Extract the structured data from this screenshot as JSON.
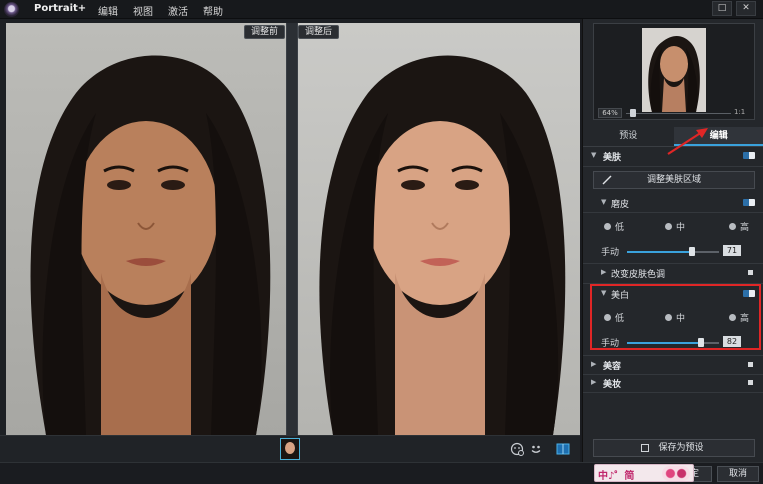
{
  "app": {
    "title": "Portrait+"
  },
  "menu": [
    "编辑",
    "视图",
    "激活",
    "帮助"
  ],
  "window_controls": {
    "restore": "□",
    "close": "✕"
  },
  "photos": {
    "before_label": "调整前",
    "after_label": "调整后"
  },
  "preview": {
    "zoom": "64%",
    "ratio": "1:1"
  },
  "tabs": [
    {
      "label": "预设",
      "active": false
    },
    {
      "label": "编辑",
      "active": true
    }
  ],
  "sections": {
    "beauty": {
      "label": "美肤",
      "adjust_area_button": "调整美肤区域"
    },
    "smooth": {
      "label": "磨皮",
      "levels": [
        "低",
        "中",
        "高"
      ],
      "manual_label": "手动",
      "manual_value": "71"
    },
    "skin_tone": {
      "label": "改变皮肤色调"
    },
    "whiten": {
      "label": "美白",
      "levels": [
        "低",
        "中",
        "高"
      ],
      "manual_label": "手动",
      "manual_value": "82"
    },
    "face_shape": {
      "label": "美容"
    },
    "makeup": {
      "label": "美妆"
    }
  },
  "save_preset_button": "保存为预设",
  "footer": {
    "ok": "确定",
    "cancel": "取消"
  },
  "watermark": {
    "text": "中♪゜简"
  },
  "colors": {
    "accent": "#3aa2dc",
    "highlight": "#e02626"
  }
}
